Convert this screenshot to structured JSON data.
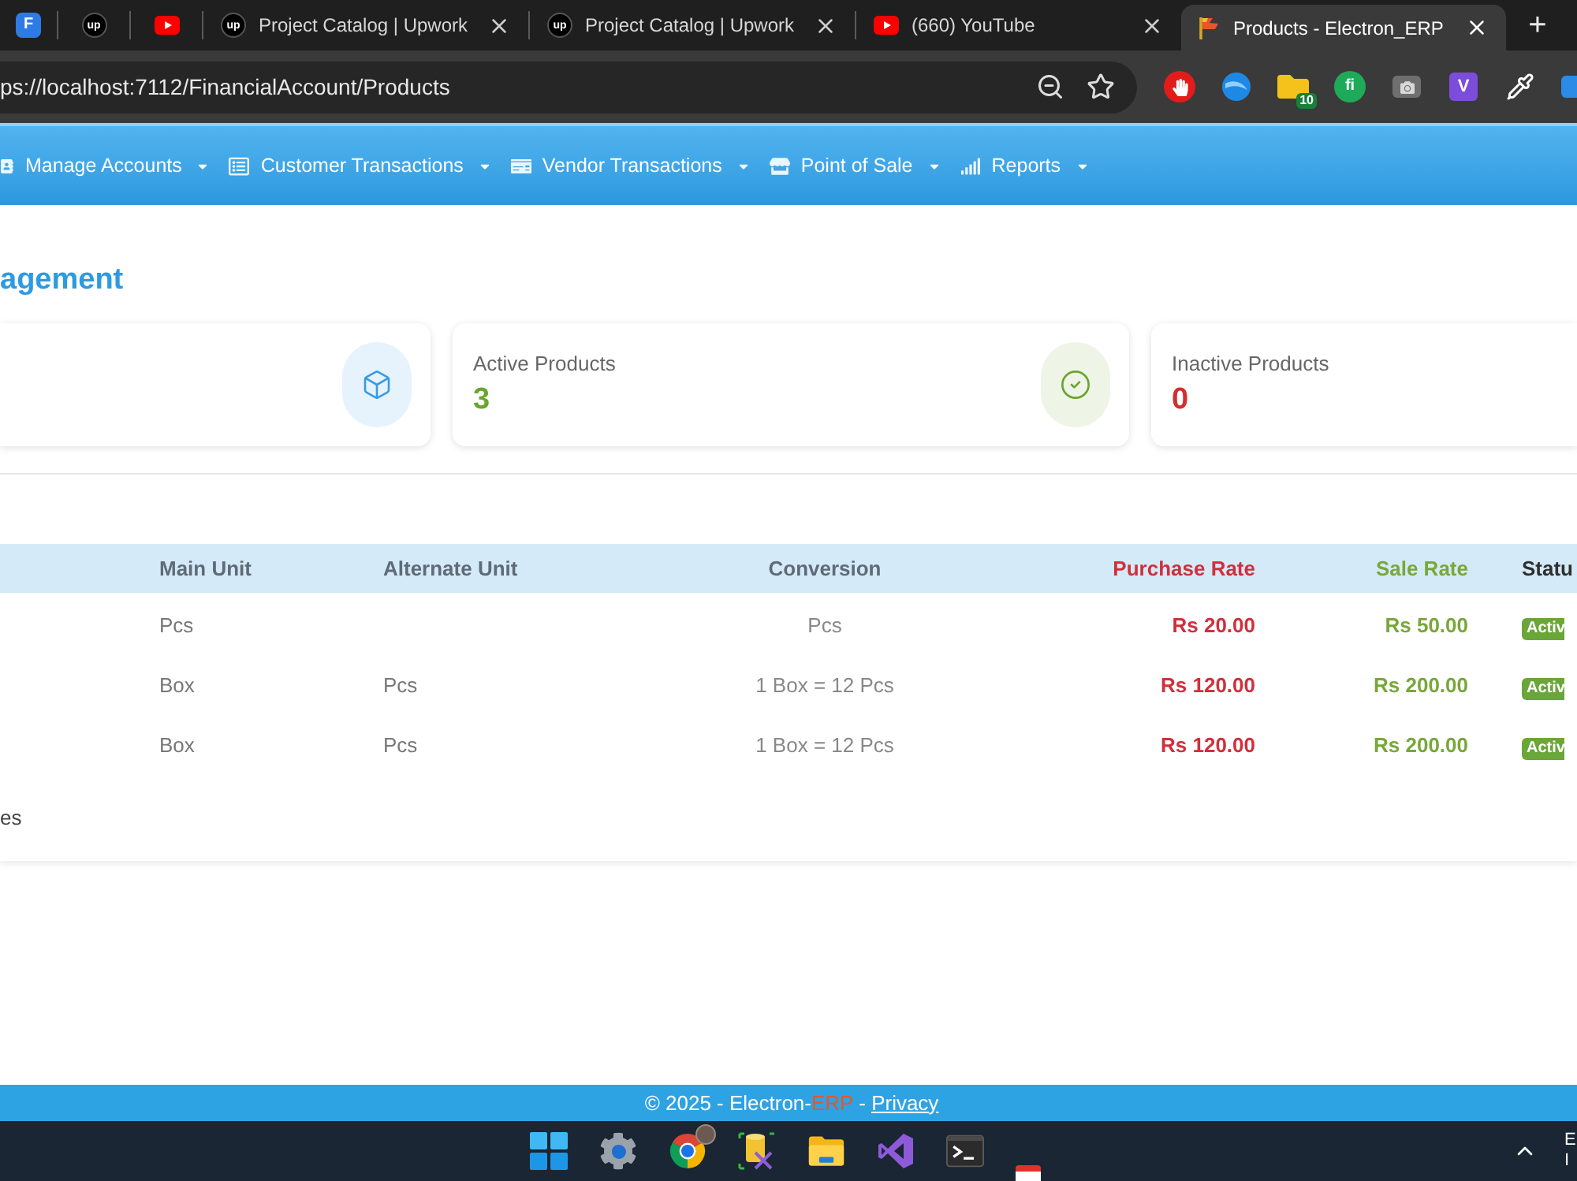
{
  "browser": {
    "tabs": [
      {
        "kind": "letter",
        "favicon_text": "F",
        "selected": false
      },
      {
        "kind": "circle",
        "favicon_text": "up",
        "selected": false
      },
      {
        "kind": "play",
        "selected": false
      },
      {
        "kind": "circle",
        "favicon_text": "up",
        "title": "Project Catalog | Upwork",
        "selected": false
      },
      {
        "kind": "circle",
        "favicon_text": "up",
        "title": "Project Catalog | Upwork",
        "selected": false
      },
      {
        "kind": "play",
        "title": "(660) YouTube",
        "selected": false
      },
      {
        "kind": "flag",
        "title": "Products - Electron_ERP",
        "selected": true
      }
    ],
    "new_tab": "+",
    "address": "ps://localhost:7112/FinancialAccount/Products",
    "extensions": [
      {
        "kind": "hand"
      },
      {
        "kind": "globe"
      },
      {
        "kind": "folder",
        "badge": "10"
      },
      {
        "kind": "round",
        "text": "fi"
      },
      {
        "kind": "camera"
      },
      {
        "kind": "tile",
        "text": "V"
      },
      {
        "kind": "dropper"
      },
      {
        "kind": "edge"
      }
    ]
  },
  "nav": [
    "Manage Accounts",
    "Customer Transactions",
    "Vendor Transactions",
    "Point of Sale",
    "Reports"
  ],
  "page": {
    "title": "agement",
    "cards": [
      {
        "kind": "total"
      },
      {
        "kind": "active",
        "label": "Active Products",
        "value": "3"
      },
      {
        "kind": "inactive",
        "label": "Inactive Products",
        "value": "0"
      }
    ],
    "table": {
      "columns": [
        "Main Unit",
        "Alternate Unit",
        "Conversion",
        "Purchase Rate",
        "Sale Rate",
        "Statu"
      ],
      "rows": [
        {
          "main_unit": "Pcs",
          "conversion": "Pcs",
          "purchase_rate": "Rs 20.00",
          "sale_rate": "Rs 50.00",
          "status": "Activ"
        },
        {
          "main_unit": "Box",
          "alternate_unit": "Pcs",
          "conversion": "1 Box = 12 Pcs",
          "purchase_rate": "Rs 120.00",
          "sale_rate": "Rs 200.00",
          "status": "Activ"
        },
        {
          "main_unit": "Box",
          "alternate_unit": "Pcs",
          "conversion": "1 Box = 12 Pcs",
          "purchase_rate": "Rs 120.00",
          "sale_rate": "Rs 200.00",
          "status": "Activ"
        }
      ]
    },
    "table_info": "es"
  },
  "footer": {
    "copyright": "© 2025 - Electron-",
    "brand_suffix": "ERP",
    "separator": " - ",
    "link": "Privacy"
  },
  "taskbar": {
    "apps": [
      {
        "kind": "start"
      },
      {
        "kind": "settings"
      },
      {
        "kind": "browser"
      },
      {
        "kind": "dbtools"
      },
      {
        "kind": "files"
      },
      {
        "kind": "ide"
      },
      {
        "kind": "terminal"
      }
    ],
    "tray_texts": [
      "E",
      "I"
    ]
  }
}
